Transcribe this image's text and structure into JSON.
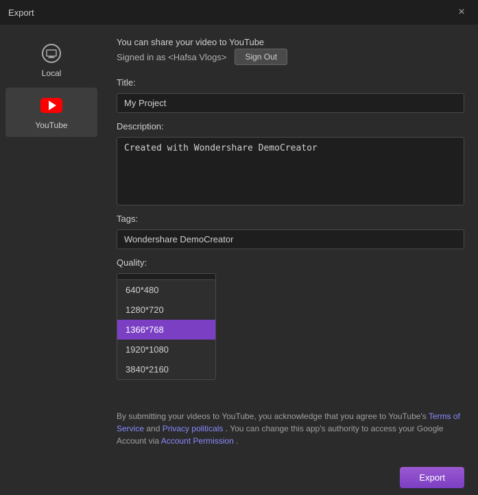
{
  "window": {
    "title": "Export",
    "close_label": "×"
  },
  "sidebar": {
    "items": [
      {
        "id": "local",
        "label": "Local",
        "icon": "local-icon"
      },
      {
        "id": "youtube",
        "label": "YouTube",
        "icon": "youtube-icon",
        "active": true
      }
    ]
  },
  "main": {
    "share_text": "You can share your video to YouTube",
    "signed_in_text": "Signed in as <Hafsa Vlogs>",
    "sign_out_label": "Sign Out",
    "title_label": "Title:",
    "title_value": "My Project",
    "description_label": "Description:",
    "description_value": "Created with Wondershare DemoCreator",
    "tags_label": "Tags:",
    "tags_value": "Wondershare DemoCreator",
    "quality_label": "Quality:",
    "quality_selected": "1366*768",
    "quality_options": [
      {
        "value": "640*480",
        "label": "640*480",
        "selected": false
      },
      {
        "value": "1280*720",
        "label": "1280*720",
        "selected": false
      },
      {
        "value": "1366*768",
        "label": "1366*768",
        "selected": true
      },
      {
        "value": "1920*1080",
        "label": "1920*1080",
        "selected": false
      },
      {
        "value": "3840*2160",
        "label": "3840*2160",
        "selected": false
      }
    ],
    "footer_text_1": "By submitting your videos to YouTube, you acknowledge that you agree to YouTube's ",
    "footer_link1": "Terms of Service",
    "footer_text_2": " and ",
    "footer_link2": "Privacy politicals",
    "footer_text_3": " . You can change this app's authority to access your Google Account via ",
    "footer_link3": "Account Permission",
    "footer_text_4": " ."
  },
  "toolbar": {
    "export_label": "Export"
  }
}
